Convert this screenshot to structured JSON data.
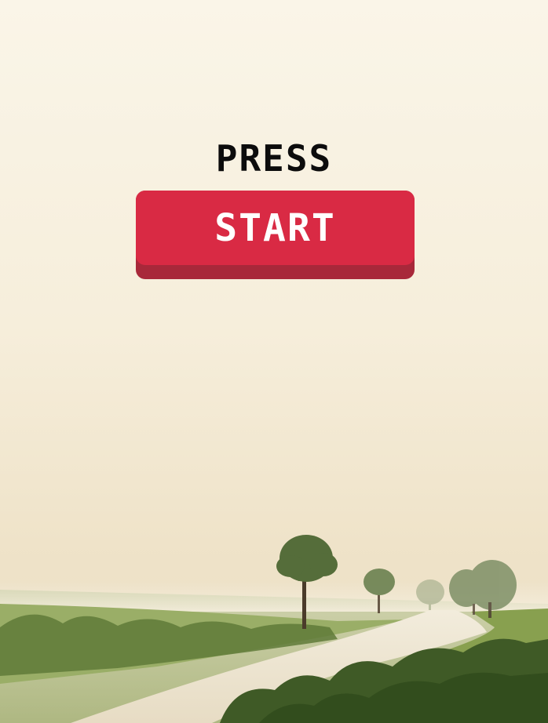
{
  "screen": {
    "prompt_text": "PRESS",
    "start_button_label": "START"
  },
  "colors": {
    "sky": "#faf5e8",
    "button_face": "#d92a44",
    "button_shadow": "#a8283a",
    "prompt_text": "#0c0c0c",
    "button_text": "#ffffff"
  }
}
